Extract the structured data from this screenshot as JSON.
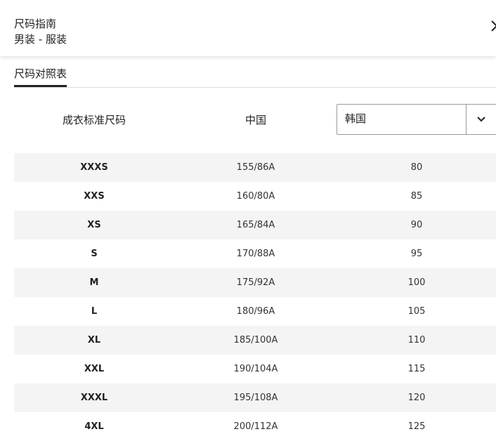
{
  "header": {
    "title": "尺码指南",
    "subtitle": "男装 - 服装"
  },
  "tabs": [
    {
      "label": "尺码对照表",
      "active": true
    }
  ],
  "table": {
    "headers": {
      "standard": "成衣标准尺码",
      "china": "中国"
    },
    "region_select": {
      "value": "韩国"
    },
    "rows": [
      {
        "size": "XXXS",
        "china": "155/86A",
        "region": "80"
      },
      {
        "size": "XXS",
        "china": "160/80A",
        "region": "85"
      },
      {
        "size": "XS",
        "china": "165/84A",
        "region": "90"
      },
      {
        "size": "S",
        "china": "170/88A",
        "region": "95"
      },
      {
        "size": "M",
        "china": "175/92A",
        "region": "100"
      },
      {
        "size": "L",
        "china": "180/96A",
        "region": "105"
      },
      {
        "size": "XL",
        "china": "185/100A",
        "region": "110"
      },
      {
        "size": "XXL",
        "china": "190/104A",
        "region": "115"
      },
      {
        "size": "XXXL",
        "china": "195/108A",
        "region": "120"
      },
      {
        "size": "4XL",
        "china": "200/112A",
        "region": "125"
      }
    ]
  },
  "colors": {
    "row_shade": "#f4f4f4",
    "text": "#222222",
    "border": "#999999"
  }
}
